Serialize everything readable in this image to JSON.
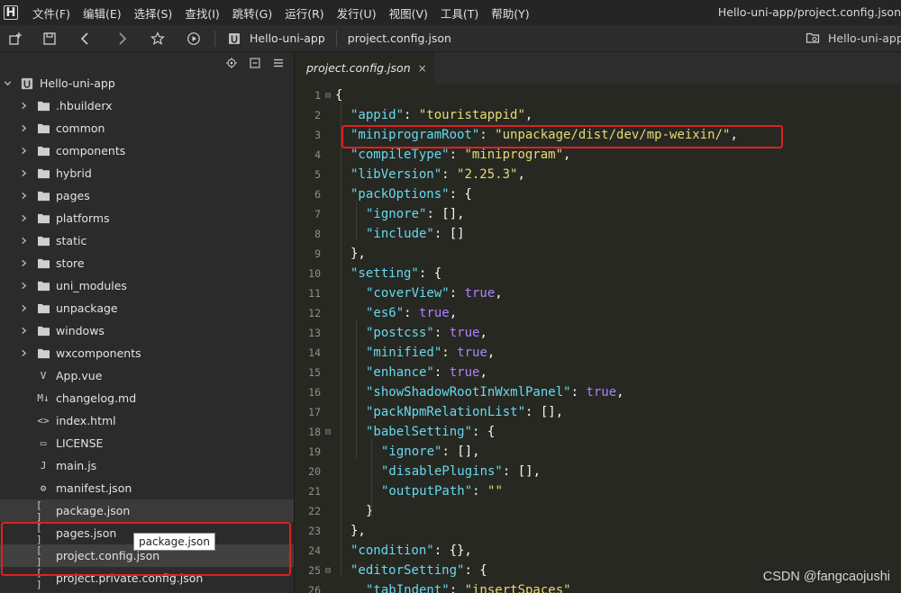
{
  "menubar": {
    "items": [
      "文件(F)",
      "编辑(E)",
      "选择(S)",
      "查找(I)",
      "跳转(G)",
      "运行(R)",
      "发行(U)",
      "视图(V)",
      "工具(T)",
      "帮助(Y)"
    ],
    "window_title": "Hello-uni-app/project.config.json"
  },
  "toolbar": {
    "crumb_project": "Hello-uni-app",
    "crumb_file": "project.config.json",
    "right_crumb": "Hello-uni-app"
  },
  "sidebar": {
    "root": "Hello-uni-app",
    "items": [
      {
        "label": ".hbuilderx",
        "type": "folder"
      },
      {
        "label": "common",
        "type": "folder"
      },
      {
        "label": "components",
        "type": "folder"
      },
      {
        "label": "hybrid",
        "type": "folder"
      },
      {
        "label": "pages",
        "type": "folder"
      },
      {
        "label": "platforms",
        "type": "folder"
      },
      {
        "label": "static",
        "type": "folder"
      },
      {
        "label": "store",
        "type": "folder"
      },
      {
        "label": "uni_modules",
        "type": "folder"
      },
      {
        "label": "unpackage",
        "type": "folder"
      },
      {
        "label": "windows",
        "type": "folder"
      },
      {
        "label": "wxcomponents",
        "type": "folder"
      },
      {
        "label": "App.vue",
        "type": "file",
        "icon": "V"
      },
      {
        "label": "changelog.md",
        "type": "file",
        "icon": "M↓"
      },
      {
        "label": "index.html",
        "type": "file",
        "icon": "<>"
      },
      {
        "label": "LICENSE",
        "type": "file",
        "icon": "▭"
      },
      {
        "label": "main.js",
        "type": "file",
        "icon": "J"
      },
      {
        "label": "manifest.json",
        "type": "file",
        "icon": "⚙"
      },
      {
        "label": "package.json",
        "type": "file",
        "icon": "[ ]"
      },
      {
        "label": "pages.json",
        "type": "file",
        "icon": "[ ]"
      },
      {
        "label": "project.config.json",
        "type": "file",
        "icon": "[ ]"
      },
      {
        "label": "project.private.config.json",
        "type": "file",
        "icon": "[ ]"
      }
    ],
    "tooltip": "package.json"
  },
  "editor": {
    "tab_label": "project.config.json",
    "tab_close": "×",
    "lines": [
      {
        "n": "1",
        "fold": "⊟",
        "indent": 0,
        "tokens": [
          [
            "p",
            "{"
          ]
        ]
      },
      {
        "n": "2",
        "indent": 1,
        "tokens": [
          [
            "k",
            "\"appid\""
          ],
          [
            "p",
            ": "
          ],
          [
            "s",
            "\"touristappid\""
          ],
          [
            "p",
            ","
          ]
        ]
      },
      {
        "n": "3",
        "indent": 1,
        "tokens": [
          [
            "k",
            "\"miniprogramRoot\""
          ],
          [
            "p",
            ": "
          ],
          [
            "s",
            "\"unpackage/dist/dev/mp-weixin/\""
          ],
          [
            "p",
            ","
          ]
        ]
      },
      {
        "n": "4",
        "indent": 1,
        "tokens": [
          [
            "k",
            "\"compileType\""
          ],
          [
            "p",
            ": "
          ],
          [
            "s",
            "\"miniprogram\""
          ],
          [
            "p",
            ","
          ]
        ]
      },
      {
        "n": "5",
        "indent": 1,
        "tokens": [
          [
            "k",
            "\"libVersion\""
          ],
          [
            "p",
            ": "
          ],
          [
            "s",
            "\"2.25.3\""
          ],
          [
            "p",
            ","
          ]
        ]
      },
      {
        "n": "6",
        "indent": 1,
        "tokens": [
          [
            "k",
            "\"packOptions\""
          ],
          [
            "p",
            ": {"
          ]
        ]
      },
      {
        "n": "7",
        "indent": 2,
        "tokens": [
          [
            "k",
            "\"ignore\""
          ],
          [
            "p",
            ": [],"
          ]
        ]
      },
      {
        "n": "8",
        "indent": 2,
        "tokens": [
          [
            "k",
            "\"include\""
          ],
          [
            "p",
            ": []"
          ]
        ]
      },
      {
        "n": "9",
        "indent": 1,
        "tokens": [
          [
            "p",
            "},"
          ]
        ]
      },
      {
        "n": "10",
        "indent": 1,
        "tokens": [
          [
            "k",
            "\"setting\""
          ],
          [
            "p",
            ": {"
          ]
        ]
      },
      {
        "n": "11",
        "indent": 2,
        "tokens": [
          [
            "k",
            "\"coverView\""
          ],
          [
            "p",
            ": "
          ],
          [
            "b",
            "true"
          ],
          [
            "p",
            ","
          ]
        ]
      },
      {
        "n": "12",
        "indent": 2,
        "tokens": [
          [
            "k",
            "\"es6\""
          ],
          [
            "p",
            ": "
          ],
          [
            "b",
            "true"
          ],
          [
            "p",
            ","
          ]
        ]
      },
      {
        "n": "13",
        "indent": 2,
        "tokens": [
          [
            "k",
            "\"postcss\""
          ],
          [
            "p",
            ": "
          ],
          [
            "b",
            "true"
          ],
          [
            "p",
            ","
          ]
        ]
      },
      {
        "n": "14",
        "indent": 2,
        "tokens": [
          [
            "k",
            "\"minified\""
          ],
          [
            "p",
            ": "
          ],
          [
            "b",
            "true"
          ],
          [
            "p",
            ","
          ]
        ]
      },
      {
        "n": "15",
        "indent": 2,
        "tokens": [
          [
            "k",
            "\"enhance\""
          ],
          [
            "p",
            ": "
          ],
          [
            "b",
            "true"
          ],
          [
            "p",
            ","
          ]
        ]
      },
      {
        "n": "16",
        "indent": 2,
        "tokens": [
          [
            "k",
            "\"showShadowRootInWxmlPanel\""
          ],
          [
            "p",
            ": "
          ],
          [
            "b",
            "true"
          ],
          [
            "p",
            ","
          ]
        ]
      },
      {
        "n": "17",
        "indent": 2,
        "tokens": [
          [
            "k",
            "\"packNpmRelationList\""
          ],
          [
            "p",
            ": [],"
          ]
        ]
      },
      {
        "n": "18",
        "fold": "⊟",
        "indent": 2,
        "tokens": [
          [
            "k",
            "\"babelSetting\""
          ],
          [
            "p",
            ": {"
          ]
        ]
      },
      {
        "n": "19",
        "indent": 3,
        "tokens": [
          [
            "k",
            "\"ignore\""
          ],
          [
            "p",
            ": [],"
          ]
        ]
      },
      {
        "n": "20",
        "indent": 3,
        "tokens": [
          [
            "k",
            "\"disablePlugins\""
          ],
          [
            "p",
            ": [],"
          ]
        ]
      },
      {
        "n": "21",
        "indent": 3,
        "tokens": [
          [
            "k",
            "\"outputPath\""
          ],
          [
            "p",
            ": "
          ],
          [
            "s",
            "\"\""
          ]
        ]
      },
      {
        "n": "22",
        "indent": 2,
        "tokens": [
          [
            "p",
            "}"
          ]
        ]
      },
      {
        "n": "23",
        "indent": 1,
        "tokens": [
          [
            "p",
            "},"
          ]
        ]
      },
      {
        "n": "24",
        "indent": 1,
        "tokens": [
          [
            "k",
            "\"condition\""
          ],
          [
            "p",
            ": {},"
          ]
        ]
      },
      {
        "n": "25",
        "fold": "⊟",
        "indent": 1,
        "tokens": [
          [
            "k",
            "\"editorSetting\""
          ],
          [
            "p",
            ": {"
          ]
        ]
      },
      {
        "n": "26",
        "indent": 2,
        "tokens": [
          [
            "k",
            "\"tabIndent\""
          ],
          [
            "p",
            ": "
          ],
          [
            "s",
            "\"insertSpaces\""
          ]
        ]
      }
    ]
  },
  "watermark": "CSDN @fangcaojushi",
  "colors": {
    "background": "#272822",
    "highlight_box": "#e02020",
    "key": "#66d9ef",
    "string": "#e6db74",
    "boolean": "#ae81ff"
  }
}
